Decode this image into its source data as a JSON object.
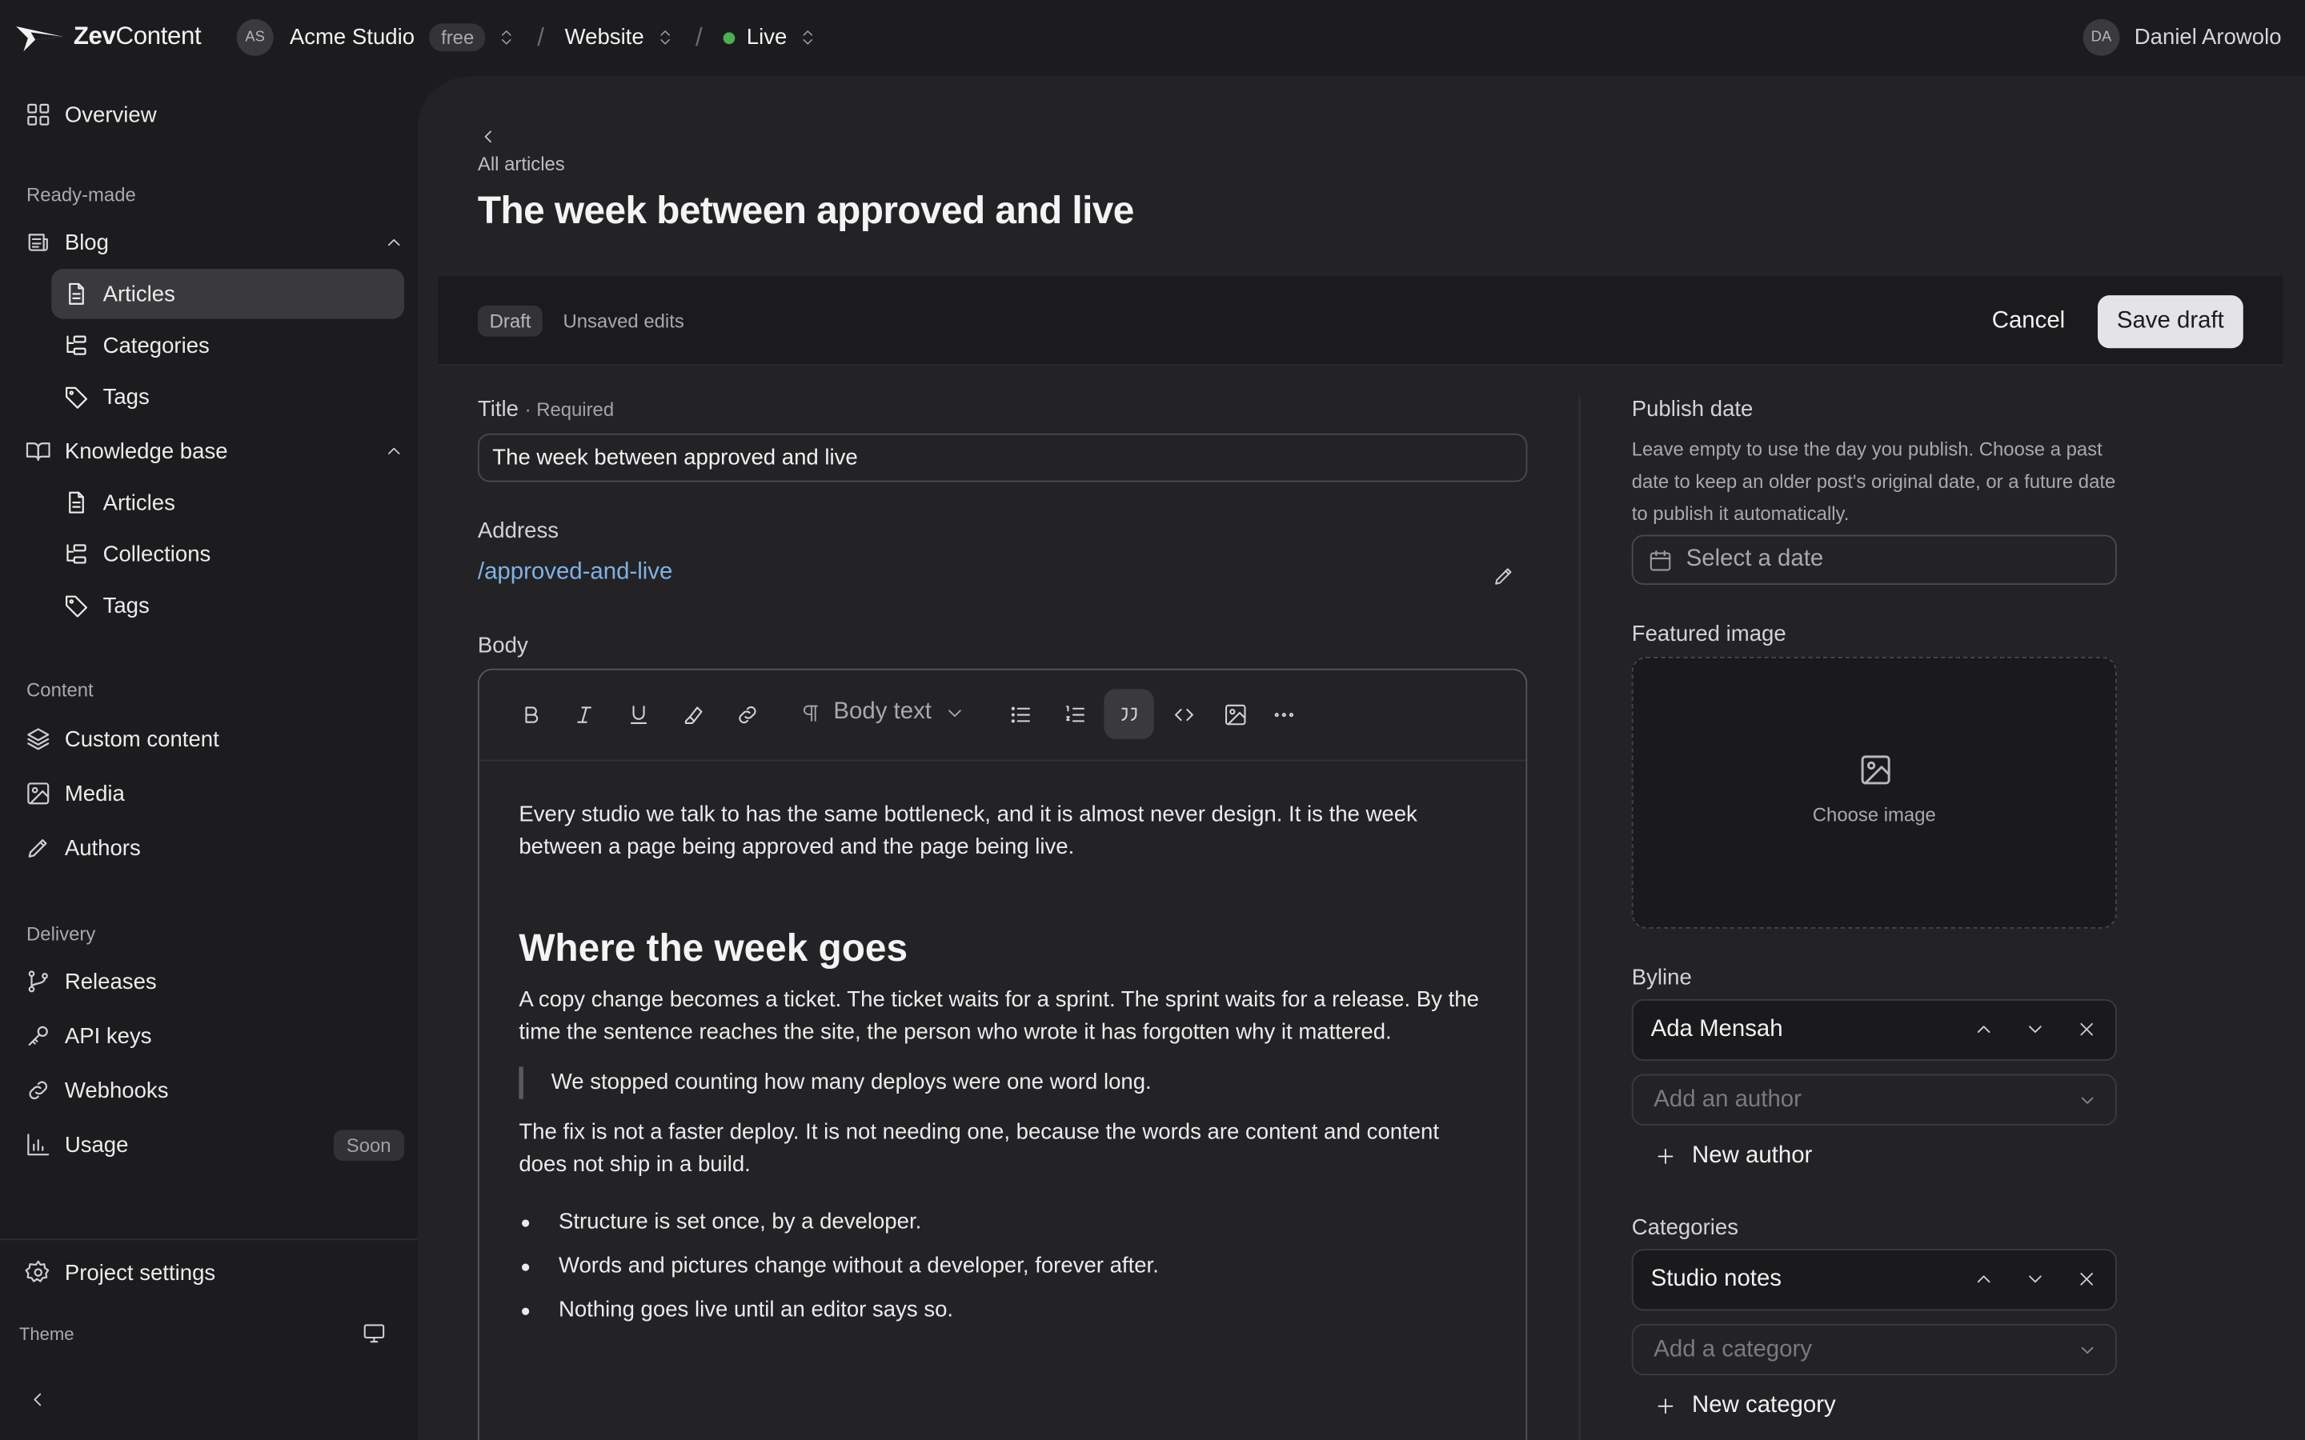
{
  "brand": {
    "name_bold": "Zev",
    "name_rest": "Content"
  },
  "workspace": {
    "initials": "AS",
    "name": "Acme Studio",
    "plan": "free"
  },
  "project": {
    "name": "Website"
  },
  "environment": {
    "name": "Live",
    "status_color": "#4caf50"
  },
  "user": {
    "initials": "DA",
    "name": "Daniel Arowolo"
  },
  "sidebar": {
    "overview": "Overview",
    "section_ready_made": "Ready-made",
    "blog": {
      "label": "Blog",
      "items": [
        "Articles",
        "Categories",
        "Tags"
      ]
    },
    "knowledge_base": {
      "label": "Knowledge base",
      "items": [
        "Articles",
        "Collections",
        "Tags"
      ]
    },
    "section_content": "Content",
    "content_items": [
      "Custom content",
      "Media",
      "Authors"
    ],
    "section_delivery": "Delivery",
    "delivery_items": [
      "Releases",
      "API keys",
      "Webhooks",
      "Usage"
    ],
    "usage_badge": "Soon",
    "project_settings": "Project settings",
    "theme_label": "Theme"
  },
  "page": {
    "back_label": "All articles",
    "title": "The week between approved and live",
    "status_badge": "Draft",
    "status_text": "Unsaved edits",
    "cancel_label": "Cancel",
    "save_label": "Save draft"
  },
  "form": {
    "title_label": "Title",
    "title_required": "· Required",
    "title_value": "The week between approved and live",
    "address_label": "Address",
    "address_value": "/approved-and-live",
    "body_label": "Body",
    "block_type": "Body text"
  },
  "body": {
    "p1": "Every studio we talk to has the same bottleneck, and it is almost never design. It is the week between a page being approved and the page being live.",
    "h2": "Where the week goes",
    "p2": "A copy change becomes a ticket. The ticket waits for a sprint. The sprint waits for a release. By the time the sentence reaches the site, the person who wrote it has forgotten why it mattered.",
    "quote": "We stopped counting how many deploys were one word long.",
    "p3": "The fix is not a faster deploy. It is not needing one, because the words are content and content does not ship in a build.",
    "bullets": [
      "Structure is set once, by a developer.",
      "Words and pictures change without a developer, forever after.",
      "Nothing goes live until an editor says so."
    ]
  },
  "side_panel": {
    "publish_label": "Publish date",
    "publish_help": "Leave empty to use the day you publish. Choose a past date to keep an older post's original date, or a future date to publish it automatically.",
    "date_placeholder": "Select a date",
    "featured_label": "Featured image",
    "choose_image": "Choose image",
    "byline_label": "Byline",
    "byline_value": "Ada Mensah",
    "add_author_placeholder": "Add an author",
    "new_author": "New author",
    "categories_label": "Categories",
    "category_value": "Studio notes",
    "add_category_placeholder": "Add a category",
    "new_category": "New category"
  }
}
